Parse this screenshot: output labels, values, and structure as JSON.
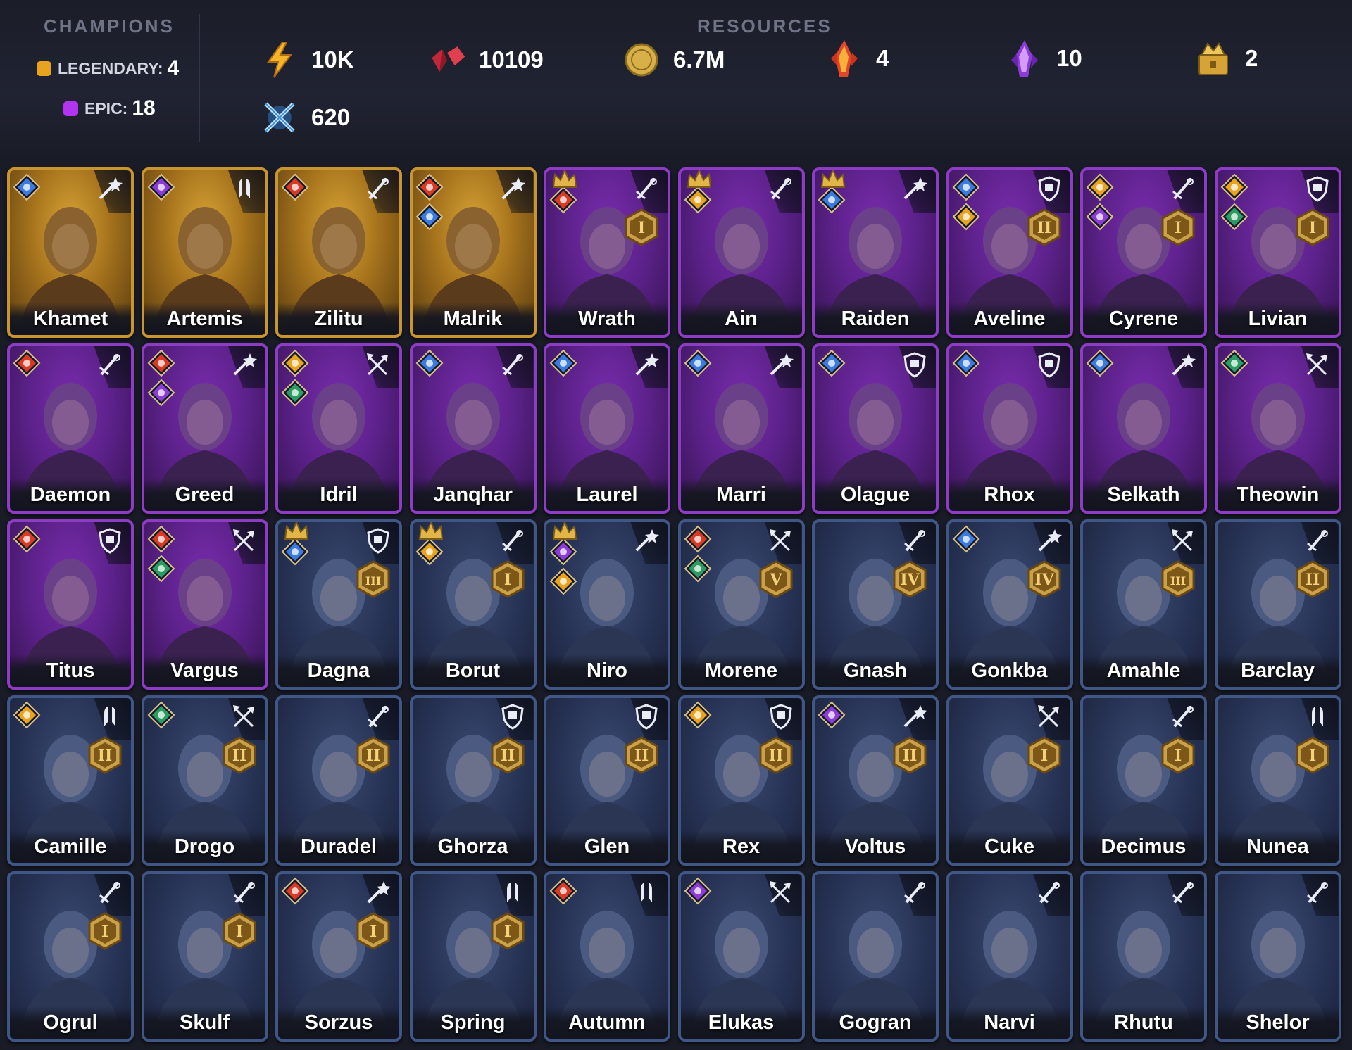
{
  "header": {
    "champions_title": "CHAMPIONS",
    "legendary_label": "LEGENDARY:",
    "legendary_count": "4",
    "epic_label": "EPIC:",
    "epic_count": "18",
    "resources_title": "RESOURCES",
    "resources": [
      {
        "icon": "energy-bolt-icon",
        "value": "10K"
      },
      {
        "icon": "gems-icon",
        "value": "10109"
      },
      {
        "icon": "gold-coin-icon",
        "value": "6.7M"
      },
      {
        "icon": "fire-shard-icon",
        "value": "4"
      },
      {
        "icon": "void-shard-icon",
        "value": "10"
      },
      {
        "icon": "gold-chest-icon",
        "value": "2"
      },
      {
        "icon": "crossed-swords-icon",
        "value": "620"
      }
    ]
  },
  "colors": {
    "legendary": "#c9952f",
    "epic": "#8e3bc6",
    "rare": "#3f5687",
    "affinity": {
      "magic": "#3b7be0",
      "force": "#d83a24",
      "spirit": "#2c9d62",
      "void": "#8b3cd8",
      "gold": "#e8a31f"
    }
  },
  "champions": [
    {
      "name": "Khamet",
      "rarity": "legendary",
      "role": "magic",
      "affinities": [
        "magic"
      ],
      "crown": false,
      "rank": ""
    },
    {
      "name": "Artemis",
      "rarity": "legendary",
      "role": "support",
      "affinities": [
        "void"
      ],
      "crown": false,
      "rank": ""
    },
    {
      "name": "Zilitu",
      "rarity": "legendary",
      "role": "melee",
      "affinities": [
        "force"
      ],
      "crown": false,
      "rank": ""
    },
    {
      "name": "Malrik",
      "rarity": "legendary",
      "role": "magic",
      "affinities": [
        "force",
        "magic"
      ],
      "crown": false,
      "rank": ""
    },
    {
      "name": "Wrath",
      "rarity": "epic",
      "role": "melee",
      "affinities": [
        "force"
      ],
      "crown": true,
      "rank": "I"
    },
    {
      "name": "Ain",
      "rarity": "epic",
      "role": "melee",
      "affinities": [
        "gold"
      ],
      "crown": true,
      "rank": ""
    },
    {
      "name": "Raiden",
      "rarity": "epic",
      "role": "magic",
      "affinities": [
        "magic"
      ],
      "crown": true,
      "rank": ""
    },
    {
      "name": "Aveline",
      "rarity": "epic",
      "role": "defense",
      "affinities": [
        "magic",
        "gold"
      ],
      "crown": false,
      "rank": "II"
    },
    {
      "name": "Cyrene",
      "rarity": "epic",
      "role": "melee",
      "affinities": [
        "gold",
        "void"
      ],
      "crown": false,
      "rank": "I"
    },
    {
      "name": "Livian",
      "rarity": "epic",
      "role": "defense",
      "affinities": [
        "gold",
        "spirit"
      ],
      "crown": false,
      "rank": "I"
    },
    {
      "name": "Daemon",
      "rarity": "epic",
      "role": "melee",
      "affinities": [
        "force"
      ],
      "crown": false,
      "rank": ""
    },
    {
      "name": "Greed",
      "rarity": "epic",
      "role": "magic",
      "affinities": [
        "force",
        "void"
      ],
      "crown": false,
      "rank": ""
    },
    {
      "name": "Idril",
      "rarity": "epic",
      "role": "ranged",
      "affinities": [
        "gold",
        "spirit"
      ],
      "crown": false,
      "rank": ""
    },
    {
      "name": "Janqhar",
      "rarity": "epic",
      "role": "melee",
      "affinities": [
        "magic"
      ],
      "crown": false,
      "rank": ""
    },
    {
      "name": "Laurel",
      "rarity": "epic",
      "role": "magic",
      "affinities": [
        "magic"
      ],
      "crown": false,
      "rank": ""
    },
    {
      "name": "Marri",
      "rarity": "epic",
      "role": "magic",
      "affinities": [
        "magic"
      ],
      "crown": false,
      "rank": ""
    },
    {
      "name": "Olague",
      "rarity": "epic",
      "role": "defense",
      "affinities": [
        "magic"
      ],
      "crown": false,
      "rank": ""
    },
    {
      "name": "Rhox",
      "rarity": "epic",
      "role": "defense",
      "affinities": [
        "magic"
      ],
      "crown": false,
      "rank": ""
    },
    {
      "name": "Selkath",
      "rarity": "epic",
      "role": "magic",
      "affinities": [
        "magic"
      ],
      "crown": false,
      "rank": ""
    },
    {
      "name": "Theowin",
      "rarity": "epic",
      "role": "ranged",
      "affinities": [
        "spirit"
      ],
      "crown": false,
      "rank": ""
    },
    {
      "name": "Titus",
      "rarity": "epic",
      "role": "defense",
      "affinities": [
        "force"
      ],
      "crown": false,
      "rank": ""
    },
    {
      "name": "Vargus",
      "rarity": "epic",
      "role": "ranged",
      "affinities": [
        "force",
        "spirit"
      ],
      "crown": false,
      "rank": ""
    },
    {
      "name": "Dagna",
      "rarity": "rare",
      "role": "defense",
      "affinities": [
        "magic"
      ],
      "crown": true,
      "rank": "III"
    },
    {
      "name": "Borut",
      "rarity": "rare",
      "role": "melee",
      "affinities": [
        "gold"
      ],
      "crown": true,
      "rank": "I"
    },
    {
      "name": "Niro",
      "rarity": "rare",
      "role": "magic",
      "affinities": [
        "void",
        "gold"
      ],
      "crown": true,
      "rank": ""
    },
    {
      "name": "Morene",
      "rarity": "rare",
      "role": "ranged",
      "affinities": [
        "force",
        "spirit"
      ],
      "crown": false,
      "rank": "V"
    },
    {
      "name": "Gnash",
      "rarity": "rare",
      "role": "melee",
      "affinities": [],
      "crown": false,
      "rank": "IV"
    },
    {
      "name": "Gonkba",
      "rarity": "rare",
      "role": "magic",
      "affinities": [
        "magic"
      ],
      "crown": false,
      "rank": "IV"
    },
    {
      "name": "Amahle",
      "rarity": "rare",
      "role": "ranged",
      "affinities": [],
      "crown": false,
      "rank": "III"
    },
    {
      "name": "Barclay",
      "rarity": "rare",
      "role": "melee",
      "affinities": [],
      "crown": false,
      "rank": "II"
    },
    {
      "name": "Camille",
      "rarity": "rare",
      "role": "support",
      "affinities": [
        "gold"
      ],
      "crown": false,
      "rank": "II"
    },
    {
      "name": "Drogo",
      "rarity": "rare",
      "role": "ranged",
      "affinities": [
        "spirit"
      ],
      "crown": false,
      "rank": "II"
    },
    {
      "name": "Duradel",
      "rarity": "rare",
      "role": "melee",
      "affinities": [],
      "crown": false,
      "rank": "II"
    },
    {
      "name": "Ghorza",
      "rarity": "rare",
      "role": "defense",
      "affinities": [],
      "crown": false,
      "rank": "II"
    },
    {
      "name": "Glen",
      "rarity": "rare",
      "role": "defense",
      "affinities": [],
      "crown": false,
      "rank": "II"
    },
    {
      "name": "Rex",
      "rarity": "rare",
      "role": "defense",
      "affinities": [
        "gold"
      ],
      "crown": false,
      "rank": "II"
    },
    {
      "name": "Voltus",
      "rarity": "rare",
      "role": "magic",
      "affinities": [
        "void"
      ],
      "crown": false,
      "rank": "II"
    },
    {
      "name": "Cuke",
      "rarity": "rare",
      "role": "ranged",
      "affinities": [],
      "crown": false,
      "rank": "I"
    },
    {
      "name": "Decimus",
      "rarity": "rare",
      "role": "melee",
      "affinities": [],
      "crown": false,
      "rank": "I"
    },
    {
      "name": "Nunea",
      "rarity": "rare",
      "role": "support",
      "affinities": [],
      "crown": false,
      "rank": "I"
    },
    {
      "name": "Ogrul",
      "rarity": "rare",
      "role": "melee",
      "affinities": [],
      "crown": false,
      "rank": "I"
    },
    {
      "name": "Skulf",
      "rarity": "rare",
      "role": "melee",
      "affinities": [],
      "crown": false,
      "rank": "I"
    },
    {
      "name": "Sorzus",
      "rarity": "rare",
      "role": "magic",
      "affinities": [
        "force"
      ],
      "crown": false,
      "rank": "I"
    },
    {
      "name": "Spring",
      "rarity": "rare",
      "role": "support",
      "affinities": [],
      "crown": false,
      "rank": "I"
    },
    {
      "name": "Autumn",
      "rarity": "rare",
      "role": "support",
      "affinities": [
        "force"
      ],
      "crown": false,
      "rank": ""
    },
    {
      "name": "Elukas",
      "rarity": "rare",
      "role": "ranged",
      "affinities": [
        "void"
      ],
      "crown": false,
      "rank": ""
    },
    {
      "name": "Gogran",
      "rarity": "rare",
      "role": "melee",
      "affinities": [],
      "crown": false,
      "rank": ""
    },
    {
      "name": "Narvi",
      "rarity": "rare",
      "role": "melee",
      "affinities": [],
      "crown": false,
      "rank": ""
    },
    {
      "name": "Rhutu",
      "rarity": "rare",
      "role": "melee",
      "affinities": [],
      "crown": false,
      "rank": ""
    },
    {
      "name": "Shelor",
      "rarity": "rare",
      "role": "melee",
      "affinities": [],
      "crown": false,
      "rank": ""
    }
  ]
}
